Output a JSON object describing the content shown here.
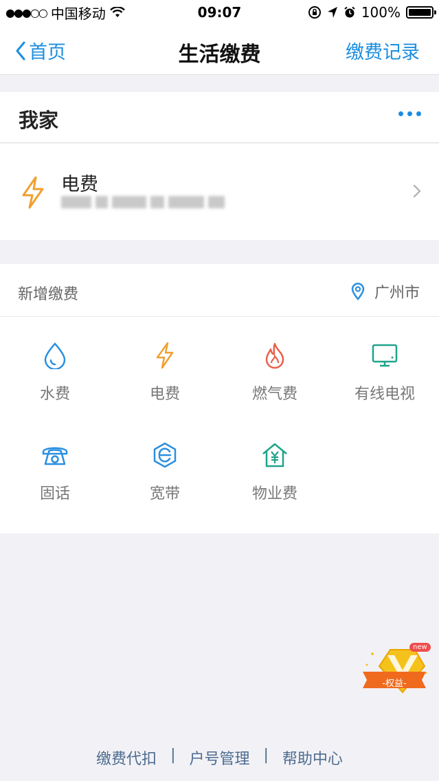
{
  "status_bar": {
    "carrier": "中国移动",
    "time": "09:07",
    "battery": "100%"
  },
  "nav": {
    "back_label": "首页",
    "title": "生活缴费",
    "right_label": "缴费记录"
  },
  "home": {
    "title": "我家"
  },
  "bills": [
    {
      "name": "电费",
      "icon": "lightning-icon",
      "color": "#f0a030"
    }
  ],
  "add_payment": {
    "title": "新增缴费",
    "city": "广州市",
    "items": [
      {
        "label": "水费",
        "icon": "water-drop-icon",
        "color": "#2a8fe0"
      },
      {
        "label": "电费",
        "icon": "lightning-icon",
        "color": "#f0a030"
      },
      {
        "label": "燃气费",
        "icon": "flame-icon",
        "color": "#e8604c"
      },
      {
        "label": "有线电视",
        "icon": "tv-icon",
        "color": "#1fa38a"
      },
      {
        "label": "固话",
        "icon": "telephone-icon",
        "color": "#2a8fe0"
      },
      {
        "label": "宽带",
        "icon": "broadband-icon",
        "color": "#2a8fe0"
      },
      {
        "label": "物业费",
        "icon": "property-house-icon",
        "color": "#1fa38a"
      }
    ]
  },
  "footer": {
    "links": [
      "缴费代扣",
      "户号管理",
      "帮助中心"
    ],
    "separator": "|"
  },
  "badge": {
    "new": "new",
    "text": "-权益-"
  }
}
